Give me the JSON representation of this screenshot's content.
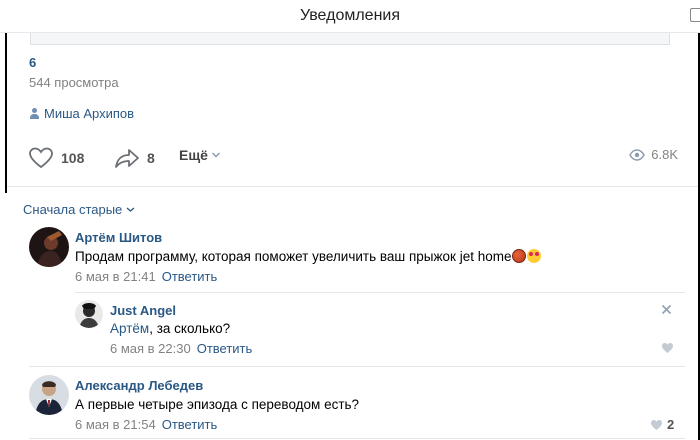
{
  "header": {
    "title": "Уведомления"
  },
  "post": {
    "number": "6",
    "views_text": "544 просмотра",
    "author": "Миша Архипов",
    "likes": "108",
    "shares": "8",
    "more_label": "Ещё",
    "views_count": "6.8K"
  },
  "comments_sort": {
    "label": "Сначала старые"
  },
  "comments": [
    {
      "author": "Артём Шитов",
      "text": "Продам программу, которая поможет увеличить ваш прыжок jet home",
      "date": "6 мая в 21:41",
      "reply_label": "Ответить"
    },
    {
      "author": "Just Angel",
      "mention": "Артём",
      "text": ", за сколько?",
      "date": "6 мая в 22:30",
      "reply_label": "Ответить"
    },
    {
      "author": "Александр Лебедев",
      "text": "А первые четыре эпизода с переводом есть?",
      "date": "6 мая в 21:54",
      "reply_label": "Ответить",
      "likes": "2"
    }
  ],
  "colors": {
    "link": "#2a5885",
    "muted": "#828282",
    "divider": "#e7e8ec"
  },
  "icons": [
    "external-link-icon",
    "person-icon",
    "heart-icon",
    "share-icon",
    "chevron-down-icon",
    "eye-icon",
    "close-icon",
    "basketball-emoji",
    "heart-eyes-emoji"
  ]
}
